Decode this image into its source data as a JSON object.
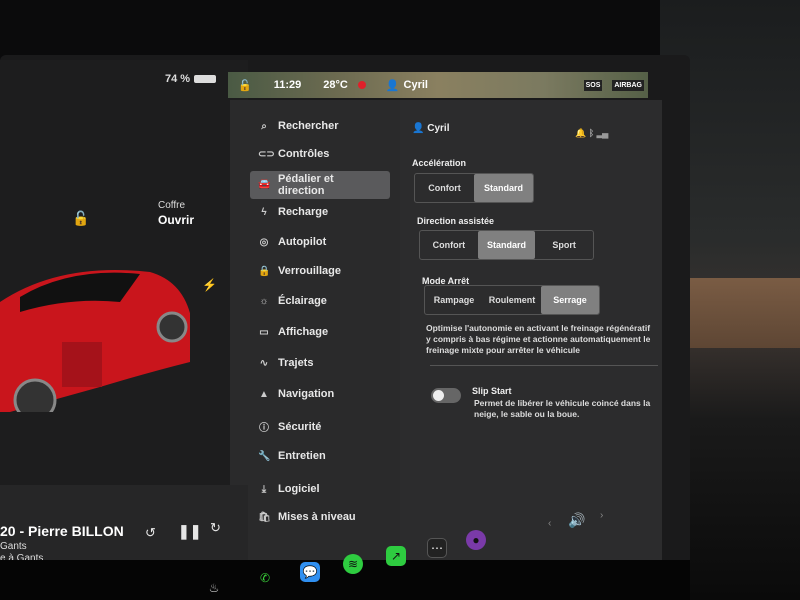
{
  "status": {
    "battery": "74 %",
    "time": "11:29",
    "temperature": "28°C",
    "user": "Cyril"
  },
  "car": {
    "trunk_label": "Coffre",
    "trunk_state": "Ouvrir"
  },
  "sidebar": {
    "items": [
      {
        "label": "Rechercher",
        "icon": "search-icon"
      },
      {
        "label": "Contrôles",
        "icon": "toggle-icon"
      },
      {
        "label": "Pédalier et direction",
        "icon": "car-icon",
        "active": true
      },
      {
        "label": "Recharge",
        "icon": "bolt-icon"
      },
      {
        "label": "Autopilot",
        "icon": "steering-wheel-icon"
      },
      {
        "label": "Verrouillage",
        "icon": "lock-icon"
      },
      {
        "label": "Éclairage",
        "icon": "sun-icon"
      },
      {
        "label": "Affichage",
        "icon": "display-icon"
      },
      {
        "label": "Trajets",
        "icon": "route-icon"
      },
      {
        "label": "Navigation",
        "icon": "navigation-icon"
      },
      {
        "label": "Sécurité",
        "icon": "info-icon"
      },
      {
        "label": "Entretien",
        "icon": "wrench-icon"
      },
      {
        "label": "Logiciel",
        "icon": "download-icon"
      },
      {
        "label": "Mises à niveau",
        "icon": "bag-icon"
      }
    ]
  },
  "content": {
    "profile": "Cyril",
    "acceleration": {
      "label": "Accélération",
      "options": [
        "Confort",
        "Standard"
      ],
      "selected": "Standard"
    },
    "steering": {
      "label": "Direction assistée",
      "options": [
        "Confort",
        "Standard",
        "Sport"
      ],
      "selected": "Standard"
    },
    "stop_mode": {
      "label": "Mode Arrêt",
      "options": [
        "Rampage",
        "Roulement",
        "Serrage"
      ],
      "selected": "Serrage",
      "description": "Optimise l'autonomie en activant le freinage régénératif y compris à bas régime et actionne automatiquement le freinage mixte pour arrêter le véhicule"
    },
    "slip_start": {
      "label": "Slip Start",
      "description": "Permet de libérer le véhicule coincé dans la neige, le sable ou la boue.",
      "enabled": false
    }
  },
  "media": {
    "title": "20 - Pierre BILLON",
    "line2": "Gants",
    "line3": "e à Gants"
  },
  "colors": {
    "accent_red": "#e0202a",
    "selected_segment": "#808080"
  }
}
